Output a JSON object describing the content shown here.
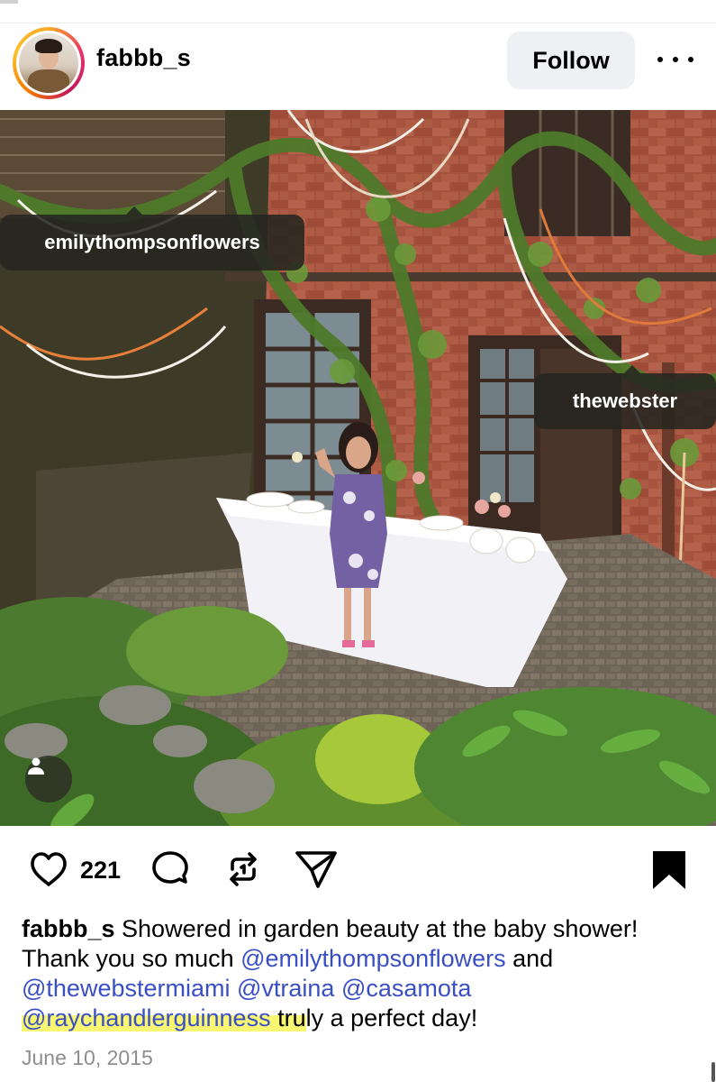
{
  "post": {
    "username": "fabbb_s",
    "follow_label": "Follow",
    "more_label": "More options",
    "photo_tags": [
      "emilythompsonflowers",
      "thewebster"
    ],
    "likes": "221",
    "caption": {
      "username": "fabbb_s",
      "text1": " Showered in garden beauty at the baby shower! Thank you so much ",
      "mention1": "@emilythompsonflowers",
      "text2": " and ",
      "mention2": "@thewebstermiami",
      "mention3": "@vtraina",
      "mention4": "@casamota",
      "mention5": "@raychandlerguinness",
      "text3_hl": " tru",
      "text3": "ly a perfect day!"
    },
    "date": "June 10, 2015"
  },
  "colors": {
    "mention": "#3b4fc4",
    "highlight": "#f6f45a",
    "follow_bg": "#eef0f3",
    "date": "#8e8e8e"
  },
  "icons": [
    "more-icon",
    "heart-icon",
    "comment-icon",
    "repost-icon",
    "share-icon",
    "bookmark-icon",
    "person-tag-icon"
  ]
}
